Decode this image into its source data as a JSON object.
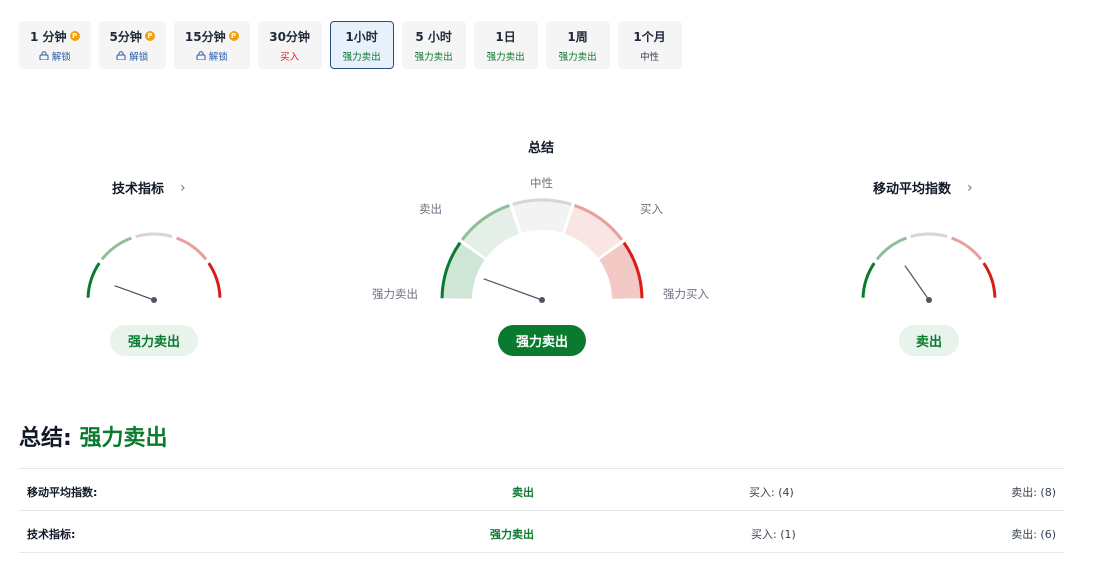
{
  "tabs": [
    {
      "label": "1 分钟",
      "sub": "解锁",
      "pro": true,
      "locked": true,
      "status": "unlock",
      "active": false
    },
    {
      "label": "5分钟",
      "sub": "解锁",
      "pro": true,
      "locked": true,
      "status": "unlock",
      "active": false
    },
    {
      "label": "15分钟",
      "sub": "解锁",
      "pro": true,
      "locked": true,
      "status": "unlock",
      "active": false
    },
    {
      "label": "30分钟",
      "sub": "买入",
      "pro": false,
      "locked": false,
      "status": "buy",
      "active": false
    },
    {
      "label": "1小时",
      "sub": "强力卖出",
      "pro": false,
      "locked": false,
      "status": "strongsell",
      "active": true
    },
    {
      "label": "5 小时",
      "sub": "强力卖出",
      "pro": false,
      "locked": false,
      "status": "strongsell",
      "active": false
    },
    {
      "label": "1日",
      "sub": "强力卖出",
      "pro": false,
      "locked": false,
      "status": "strongsell",
      "active": false
    },
    {
      "label": "1周",
      "sub": "强力卖出",
      "pro": false,
      "locked": false,
      "status": "strongsell",
      "active": false
    },
    {
      "label": "1个月",
      "sub": "中性",
      "pro": false,
      "locked": false,
      "status": "neutral",
      "active": false
    }
  ],
  "pro_badge": "P",
  "gauges": {
    "technical": {
      "title": "技术指标",
      "chevron": "›",
      "value": "强力卖出",
      "needle_angle_deg": 160
    },
    "summary": {
      "title": "总结",
      "value": "强力卖出",
      "needle_angle_deg": 160,
      "labels": {
        "neutral": "中性",
        "sell": "卖出",
        "buy": "买入",
        "strong_sell": "强力卖出",
        "strong_buy": "强力买入"
      }
    },
    "moving_avg": {
      "title": "移动平均指数",
      "chevron": "›",
      "value": "卖出",
      "needle_angle_deg": 125
    }
  },
  "summary_heading": {
    "label": "总结:",
    "value": "强力卖出"
  },
  "summary_table": [
    {
      "name": "移动平均指数:",
      "status": "卖出",
      "buy": "买入: (4)",
      "sell": "卖出: (8)"
    },
    {
      "name": "技术指标:",
      "status": "强力卖出",
      "buy": "买入: (1)",
      "sell": "卖出: (6)"
    }
  ],
  "colors": {
    "strong_sell": "#0a7a2f",
    "sell": "#8fbf9a",
    "neutral": "#d6d6d6",
    "buy": "#e8a09a",
    "strong_buy": "#d91e18",
    "active_border": "#2a4d80",
    "unlock": "#2a5ca8"
  },
  "icons": {
    "lock": "lock-icon",
    "pro": "pro-badge-icon",
    "chevron": "chevron-right-icon"
  }
}
